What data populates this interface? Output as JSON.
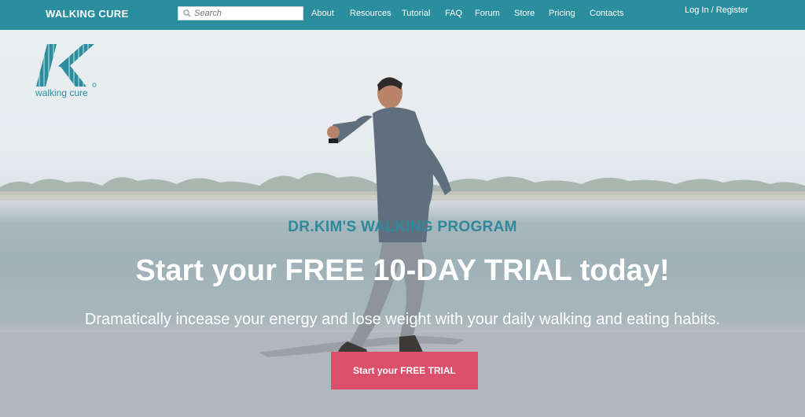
{
  "header": {
    "brand": "WALKING CURE",
    "search": {
      "placeholder": "Search"
    },
    "nav": [
      "About",
      "Resources",
      "Tutorial",
      "FAQ",
      "Forum",
      "Store",
      "Pricing",
      "Contacts"
    ],
    "login": "Log In / Register"
  },
  "logo": {
    "text": "walking cure"
  },
  "hero": {
    "subtitle": "DR.KIM'S WALKING PROGRAM",
    "headline": "Start your FREE 10-DAY TRIAL today!",
    "tagline": "Dramatically incease your energy and lose weight with your daily walking and eating habits.",
    "cta": "Start your FREE TRIAL"
  },
  "colors": {
    "header_bg": "#2b8e9e",
    "accent": "#2e8a9a",
    "cta_bg": "#dc4f6b"
  }
}
